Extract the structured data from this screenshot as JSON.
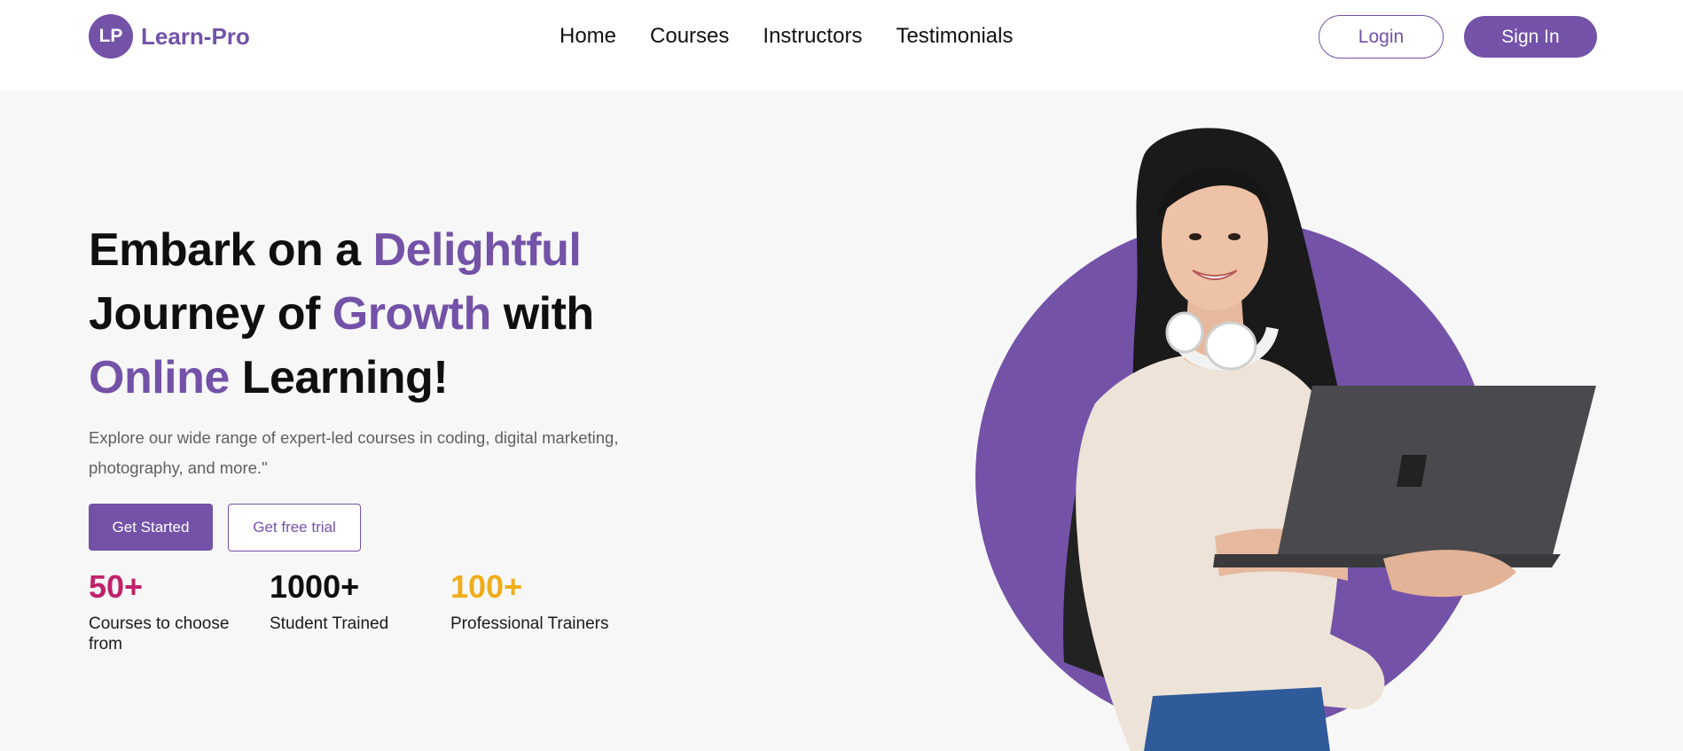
{
  "brand": {
    "badge": "LP",
    "name": "Learn-Pro"
  },
  "nav": [
    {
      "label": "Home"
    },
    {
      "label": "Courses"
    },
    {
      "label": "Instructors"
    },
    {
      "label": "Testimonials"
    }
  ],
  "auth": {
    "login": "Login",
    "signin": "Sign In"
  },
  "hero": {
    "title": {
      "p1": "Embark on a ",
      "p2": "Delightful",
      "p3": "Journey of ",
      "p4": "Growth",
      "p5": " with",
      "p6": "Online",
      "p7": " Learning!"
    },
    "subtitle": "Explore our wide range of expert-led courses in coding, digital marketing, photography, and more.\"",
    "primary_cta": "Get Started",
    "secondary_cta": "Get free trial"
  },
  "stats": [
    {
      "value": "50+",
      "label": "Courses to choose from",
      "color": "#c0226a"
    },
    {
      "value": "1000+",
      "label": "Student Trained",
      "color": "#0f0f0f"
    },
    {
      "value": "100+",
      "label": "Professional Trainers",
      "color": "#f0ad1a"
    }
  ],
  "colors": {
    "accent": "#7352a8",
    "background": "#f7f7f7"
  }
}
